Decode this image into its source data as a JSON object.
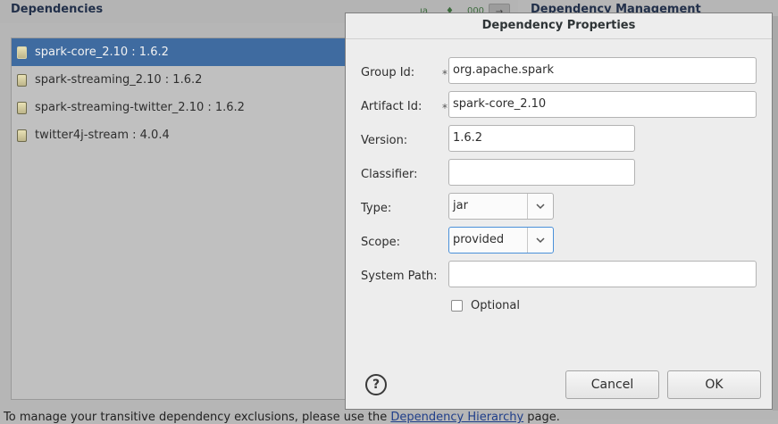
{
  "background": {
    "dependencies_title": "Dependencies",
    "management_title": "Dependency Management",
    "toolbar": [
      {
        "name": "sort-alpha-icon",
        "glyph": "ıa"
      },
      {
        "name": "dependency-icon",
        "glyph": "♦"
      },
      {
        "name": "show-groups-icon",
        "glyph": "000"
      },
      {
        "name": "filter-icon",
        "glyph": "→"
      }
    ],
    "dependencies": [
      {
        "label": "spark-core_2.10 : 1.6.2",
        "selected": true
      },
      {
        "label": "spark-streaming_2.10 : 1.6.2",
        "selected": false
      },
      {
        "label": "spark-streaming-twitter_2.10 : 1.6.2",
        "selected": false
      },
      {
        "label": "twitter4j-stream : 4.0.4",
        "selected": false
      }
    ],
    "footer_text": "To manage your transitive dependency exclusions, please use the ",
    "footer_link": "Dependency Hierarchy",
    "footer_suffix": " page."
  },
  "dialog": {
    "title": "Dependency Properties",
    "group_id_label": "Group Id:",
    "group_id_value": "org.apache.spark",
    "artifact_id_label": "Artifact Id:",
    "artifact_id_value": "spark-core_2.10",
    "version_label": "Version:",
    "version_value": "1.6.2",
    "classifier_label": "Classifier:",
    "classifier_value": "",
    "type_label": "Type:",
    "type_value": "jar",
    "scope_label": "Scope:",
    "scope_value": "provided",
    "system_path_label": "System Path:",
    "system_path_value": "",
    "required_marker": "*",
    "optional_label": "Optional",
    "optional_checked": false,
    "help_glyph": "?",
    "cancel_label": "Cancel",
    "ok_label": "OK"
  }
}
